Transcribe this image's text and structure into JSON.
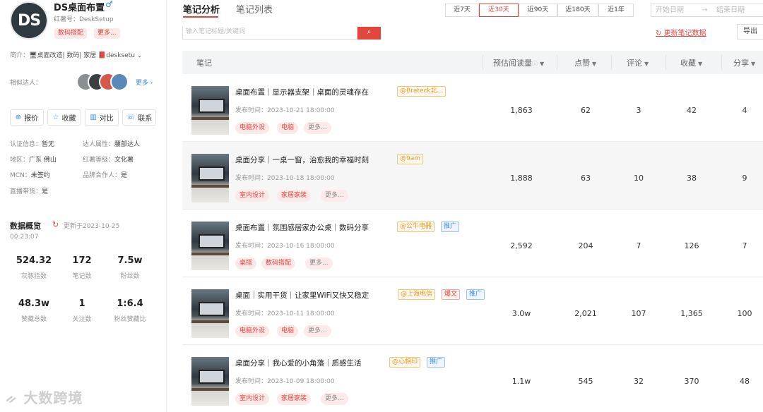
{
  "profile": {
    "avatar_text": "DS",
    "name": "DS桌面布置",
    "gender_symbol": "♂",
    "redbook_id": "红薯号：DeskSetup",
    "tags": [
      "数码搭配",
      "更多..."
    ],
    "intro_label": "简介：",
    "intro_text": "🖥桌面改造| 数码| 家居 📕desksetu",
    "similar_label": "相似达人：",
    "similar_more": "更多",
    "actions": [
      {
        "icon": "⊕",
        "label": "报价"
      },
      {
        "icon": "☆",
        "label": "收藏"
      },
      {
        "icon": "▥",
        "label": "对比"
      },
      {
        "icon": "☏",
        "label": "联系"
      }
    ],
    "info": {
      "cert": {
        "k": "认证信息：",
        "v": "暂无"
      },
      "attr": {
        "k": "达人属性：",
        "v": "腰部达人"
      },
      "region": {
        "k": "地区：",
        "v": "广东 佛山"
      },
      "level": {
        "k": "红薯等级：",
        "v": "文化薯"
      },
      "mcn": {
        "k": "MCN：",
        "v": "未签约"
      },
      "partner": {
        "k": "品牌合作人：",
        "v": "是"
      },
      "live": {
        "k": "直播带货：",
        "v": "是"
      }
    },
    "overview": {
      "title": "数据概览",
      "updated": "更新于2023-10-25",
      "updated_time": "00:23:07",
      "stats": [
        {
          "value": "524.32",
          "label": "灰豚指数"
        },
        {
          "value": "172",
          "label": "笔记数"
        },
        {
          "value": "7.5w",
          "label": "粉丝数"
        },
        {
          "value": "48.3w",
          "label": "赞藏总数"
        },
        {
          "value": "1",
          "label": "关注数"
        },
        {
          "value": "1:6.4",
          "label": "粉丝赞藏比"
        }
      ]
    },
    "watermark": "大数跨境"
  },
  "main": {
    "tabs": [
      "笔记分析",
      "笔记列表"
    ],
    "ranges": [
      "近7天",
      "近30天",
      "近90天",
      "近180天",
      "近1年"
    ],
    "active_range": "近30天",
    "date_start": "开始日期",
    "date_arrow": "→",
    "date_end": "结束日期",
    "search_placeholder": "输入笔记标题/关键词",
    "update_data": "更新笔记数据",
    "export_label": "导出",
    "columns": [
      "笔记",
      "预估阅读量",
      "点赞",
      "评论",
      "收藏",
      "分享"
    ]
  },
  "notes": [
    {
      "title": "桌面布置｜显示器支架｜桌面的灵魂存在",
      "badges": [
        {
          "type": "brand",
          "text": "@Brateck北..."
        }
      ],
      "time": "发布时间：2023-10-21 18:00:00",
      "topics": [
        "电脑外设",
        "电脑",
        "更多..."
      ],
      "reads": "1,863",
      "likes": "62",
      "comments": "3",
      "collects": "42",
      "shares": "4"
    },
    {
      "title": "桌面分享｜一桌一窗，治愈我的幸福时刻",
      "badges": [
        {
          "type": "brand",
          "text": "@9am"
        }
      ],
      "time": "发布时间：2023-10-18 18:00:00",
      "topics": [
        "室内设计",
        "家居家装",
        "更多..."
      ],
      "reads": "1,888",
      "likes": "63",
      "comments": "10",
      "collects": "38",
      "shares": "9"
    },
    {
      "title": "桌面布置｜氛围感居家办公桌｜数码分享",
      "badges": [
        {
          "type": "brand",
          "text": "@公牛电器"
        },
        {
          "type": "promo",
          "text": "推广"
        }
      ],
      "time": "发布时间：2023-10-16 18:00:00",
      "topics": [
        "桌搭",
        "数码搭配",
        "更多..."
      ],
      "reads": "2,592",
      "likes": "204",
      "comments": "7",
      "collects": "126",
      "shares": "7"
    },
    {
      "title": "桌面｜实用干货｜让家里WiFi又快又稳定",
      "badges": [
        {
          "type": "brand",
          "text": "@上海电信"
        },
        {
          "type": "hot",
          "text": "爆文"
        },
        {
          "type": "promo",
          "text": "推广"
        }
      ],
      "time": "发布时间：2023-10-11 18:00:00",
      "topics": [
        "电脑外设",
        "电脑",
        "更多..."
      ],
      "reads": "3.0w",
      "likes": "2,021",
      "comments": "107",
      "collects": "1,365",
      "shares": "100"
    },
    {
      "title": "桌面分享｜我心爱的小角落｜质感生活",
      "badges": [
        {
          "type": "brand",
          "text": "@心相印"
        },
        {
          "type": "promo",
          "text": "推广"
        }
      ],
      "time": "发布时间：2023-10-09 18:00:00",
      "topics": [
        "室内设计",
        "家居家装",
        "更多..."
      ],
      "reads": "1.1w",
      "likes": "545",
      "comments": "32",
      "collects": "370",
      "shares": "48"
    }
  ]
}
